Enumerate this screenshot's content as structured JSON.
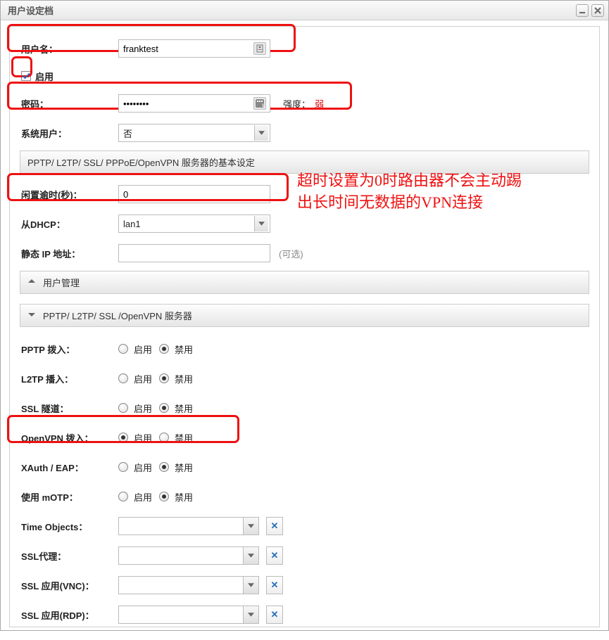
{
  "window": {
    "title": "用户设定档"
  },
  "form": {
    "username_label": "用户名：",
    "username_value": "franktest",
    "enable_label": "启用",
    "password_label": "密码：",
    "password_value": "••••••••",
    "strength_label": "强度：",
    "strength_value": "弱",
    "sysuser_label": "系统用户：",
    "sysuser_value": "否",
    "section_basic": "PPTP/ L2TP/ SSL/ PPPoE/OpenVPN 服务器的基本设定",
    "idle_label": "闲置逾时(秒)：",
    "idle_value": "0",
    "dhcp_label": "从DHCP：",
    "dhcp_value": "lan1",
    "staticip_label": "静态 IP 地址：",
    "staticip_value": "",
    "staticip_hint": "(可选)",
    "acc_usermgmt": "用户管理",
    "acc_servers": "PPTP/ L2TP/ SSL /OpenVPN 服务器",
    "radio_enable": "启用",
    "radio_disable": "禁用",
    "rows": {
      "pptp": "PPTP 拨入：",
      "l2tp": "L2TP 播入：",
      "ssl": "SSL 隧道：",
      "openvpn": "OpenVPN 拨入：",
      "xauth": "XAuth / EAP：",
      "motp": "使用 mOTP：",
      "timeobj": "Time Objects：",
      "sslproxy": "SSL代理：",
      "sslvnc": "SSL 应用(VNC)：",
      "sslrdp": "SSL 应用(RDP)："
    }
  },
  "annotation": "超时设置为0时路由器不会主动踢出长时间无数据的VPN连接"
}
